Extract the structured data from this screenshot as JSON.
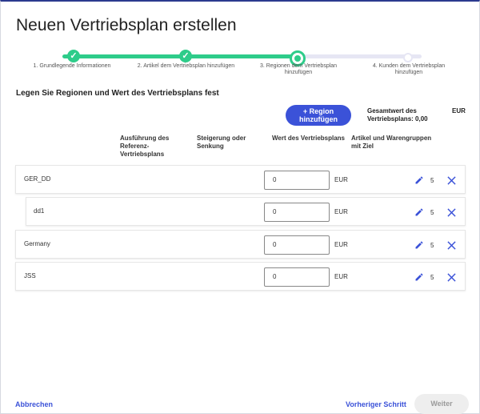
{
  "dialog": {
    "title": "Neuen Vertriebsplan erstellen",
    "section_title": "Legen Sie Regionen und Wert des Vertriebsplans fest"
  },
  "stepper": {
    "steps": [
      {
        "label": "1. Grundlegende Informationen",
        "state": "done"
      },
      {
        "label": "2. Artikel dem Vertriebsplan hinzufügen",
        "state": "done"
      },
      {
        "label": "3. Regionen dem Vertriebsplan hinzufügen",
        "state": "current"
      },
      {
        "label": "4. Kunden dem Vertriebsplan hinzufügen",
        "state": "todo"
      }
    ],
    "accent_color": "#2ecc8a"
  },
  "actions": {
    "add_region": "+ Region hinzufügen",
    "total_label": "Gesamtwert des Vertriebsplans: 0,00",
    "total_currency": "EUR"
  },
  "table": {
    "headers": {
      "reference": "Ausführung des Referenz-Vertriebsplans",
      "change": "Steigerung oder Senkung",
      "value": "Wert des Vertriebsplans",
      "articles": "Artikel und Warengruppen mit Ziel"
    },
    "rows": [
      {
        "name": "GER_DD",
        "value": "0",
        "currency": "EUR",
        "count": "5"
      },
      {
        "name": "dd1",
        "value": "0",
        "currency": "EUR",
        "count": "5"
      },
      {
        "name": "Germany",
        "value": "0",
        "currency": "EUR",
        "count": "5"
      },
      {
        "name": "JSS",
        "value": "0",
        "currency": "EUR",
        "count": "5"
      }
    ]
  },
  "footer": {
    "cancel": "Abbrechen",
    "previous": "Vorheriger Schritt",
    "next": "Weiter"
  },
  "colors": {
    "primary": "#3b52d8",
    "success": "#2ecc8a"
  }
}
